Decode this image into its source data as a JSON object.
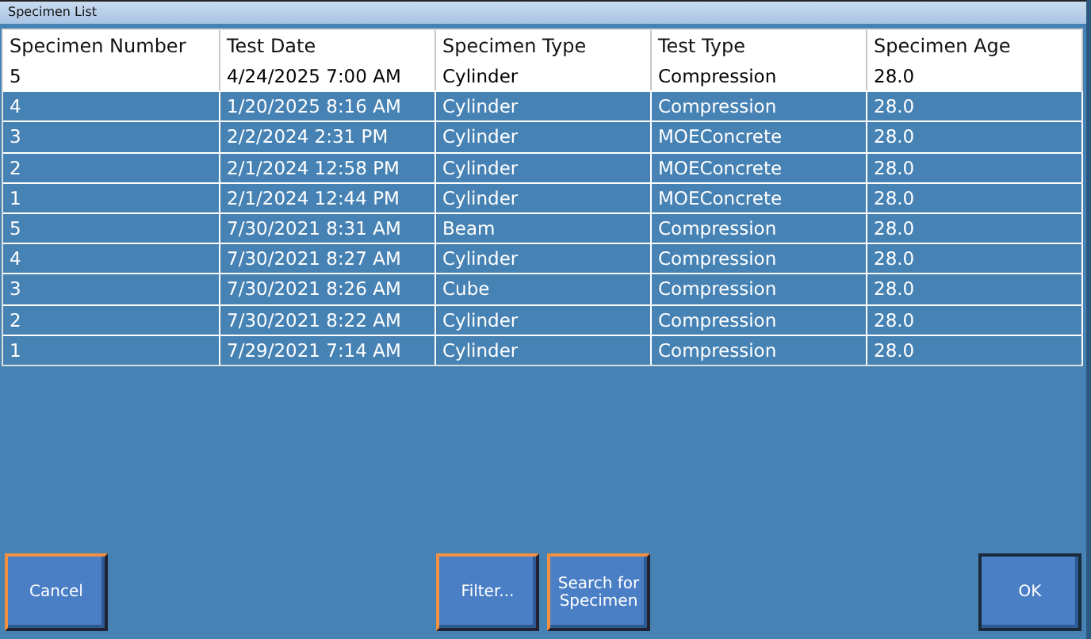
{
  "window": {
    "title": "Specimen List"
  },
  "table": {
    "columns": [
      "Specimen Number",
      "Test Date",
      "Specimen Type",
      "Test Type",
      "Specimen Age"
    ],
    "rows": [
      {
        "cells": [
          "5",
          "4/24/2025 7:00 AM",
          "Cylinder",
          "Compression",
          "28.0"
        ],
        "selected": false
      },
      {
        "cells": [
          "4",
          "1/20/2025 8:16 AM",
          "Cylinder",
          "Compression",
          "28.0"
        ],
        "selected": true
      },
      {
        "cells": [
          "3",
          "2/2/2024 2:31 PM",
          "Cylinder",
          "MOEConcrete",
          "28.0"
        ],
        "selected": true
      },
      {
        "cells": [
          "2",
          "2/1/2024 12:58 PM",
          "Cylinder",
          "MOEConcrete",
          "28.0"
        ],
        "selected": true
      },
      {
        "cells": [
          "1",
          "2/1/2024 12:44 PM",
          "Cylinder",
          "MOEConcrete",
          "28.0"
        ],
        "selected": true
      },
      {
        "cells": [
          "5",
          "7/30/2021 8:31 AM",
          "Beam",
          "Compression",
          "28.0"
        ],
        "selected": true
      },
      {
        "cells": [
          "4",
          "7/30/2021 8:27 AM",
          "Cylinder",
          "Compression",
          "28.0"
        ],
        "selected": true
      },
      {
        "cells": [
          "3",
          "7/30/2021 8:26 AM",
          "Cube",
          "Compression",
          "28.0"
        ],
        "selected": true
      },
      {
        "cells": [
          "2",
          "7/30/2021 8:22 AM",
          "Cylinder",
          "Compression",
          "28.0"
        ],
        "selected": true
      },
      {
        "cells": [
          "1",
          "7/29/2021 7:14 AM",
          "Cylinder",
          "Compression",
          "28.0"
        ],
        "selected": true
      }
    ]
  },
  "buttons": [
    {
      "label": "Cancel",
      "kind": "left"
    },
    {
      "label": "Filter...",
      "kind": "center"
    },
    {
      "label": "Search for Specimen",
      "kind": "center"
    },
    {
      "label": "OK",
      "kind": "right"
    }
  ]
}
